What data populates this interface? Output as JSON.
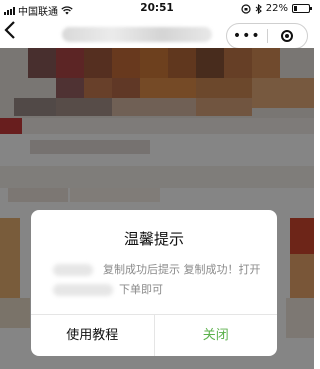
{
  "status_bar": {
    "carrier": "中国联通",
    "time": "20:51",
    "battery_percent": "22%"
  },
  "nav": {
    "back_icon": "chevron-left-icon",
    "more_icon": "ellipsis-icon",
    "close_icon": "target-circle-icon"
  },
  "dialog": {
    "title": "温馨提示",
    "message_line1": "复制成功后提示 复制成功！打开",
    "message_line2": "下单即可",
    "buttons": {
      "tutorial": "使用教程",
      "close": "关闭"
    },
    "accent_color": "#5bb14b"
  }
}
